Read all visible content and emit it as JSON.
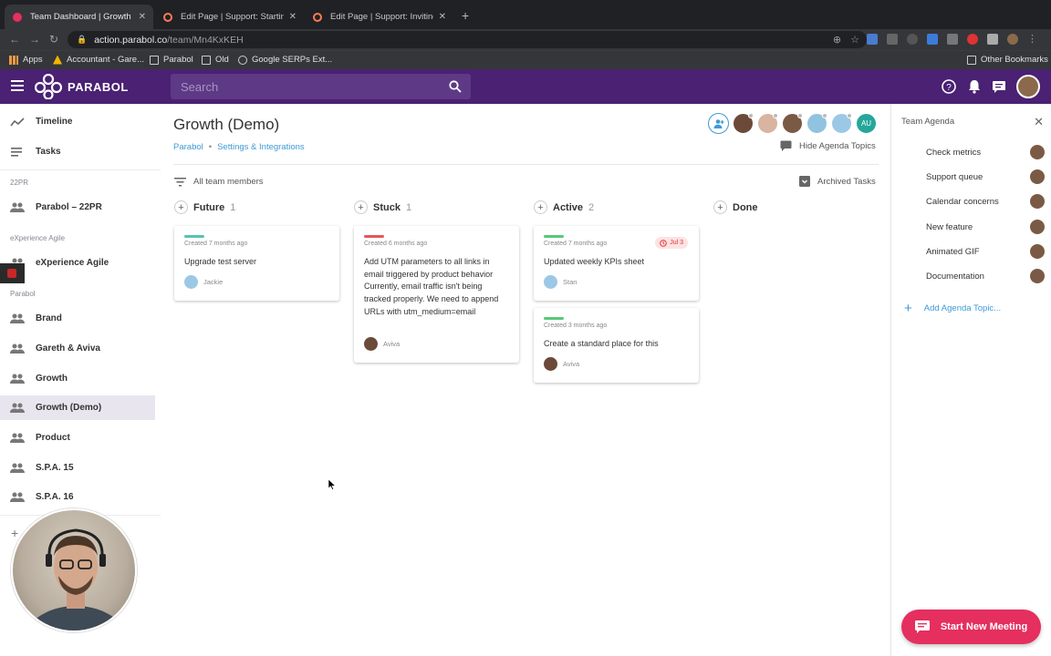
{
  "browser": {
    "tabs": [
      {
        "title": "Team Dashboard | Growth (Demo)",
        "active": true
      },
      {
        "title": "Edit Page | Support: Starting a Meeting"
      },
      {
        "title": "Edit Page | Support: Inviting & Managing"
      }
    ],
    "url_host": "action.parabol.co",
    "url_path": "/team/Mn4KxKEH",
    "bookmarks": [
      "Apps",
      "Accountant - Gare...",
      "Parabol",
      "Old",
      "Google SERPs Ext..."
    ],
    "other_bookmarks": "Other Bookmarks"
  },
  "header": {
    "brand": "PARABOL",
    "search_placeholder": "Search"
  },
  "sidebar": {
    "top_items": [
      {
        "label": "Timeline",
        "icon": "timeline-icon"
      },
      {
        "label": "Tasks",
        "icon": "tasks-icon"
      }
    ],
    "groups": [
      {
        "name": "22PR",
        "items": [
          {
            "label": "Parabol – 22PR"
          }
        ]
      },
      {
        "name": "eXperience Agile",
        "items": [
          {
            "label": "eXperience Agile"
          }
        ]
      },
      {
        "name": "Parabol",
        "items": [
          {
            "label": "Brand"
          },
          {
            "label": "Gareth & Aviva"
          },
          {
            "label": "Growth"
          },
          {
            "label": "Growth (Demo)",
            "selected": true
          },
          {
            "label": "Product"
          },
          {
            "label": "S.P.A. 15"
          },
          {
            "label": "S.P.A. 16"
          }
        ]
      }
    ]
  },
  "main": {
    "title": "Growth (Demo)",
    "breadcrumb": [
      "Parabol",
      "Settings & Integrations"
    ],
    "team_avatars": [
      "add-member",
      "person",
      "person",
      "person",
      "person",
      "person",
      "AU"
    ],
    "hide_agenda_label": "Hide Agenda Topics",
    "filter_label": "All team members",
    "archived_label": "Archived Tasks",
    "columns": [
      {
        "name": "Future",
        "count": "1",
        "cards": [
          {
            "created": "Created 7 months ago",
            "text": "Upgrade test server",
            "owner": "Jackie",
            "color": "#55c3b3"
          }
        ]
      },
      {
        "name": "Stuck",
        "count": "1",
        "cards": [
          {
            "created": "Created 6 months ago",
            "text": "Add UTM parameters to all links in email triggered by product behavior Currently, email traffic isn't being tracked properly. We need to append URLs with utm_medium=email",
            "owner": "Aviva",
            "color": "#e55757"
          }
        ]
      },
      {
        "name": "Active",
        "count": "2",
        "cards": [
          {
            "created": "Created 7 months ago",
            "text": "Updated weekly KPIs sheet",
            "owner": "Stan",
            "color": "#57c878",
            "due": "Jul 3"
          },
          {
            "created": "Created 3 months ago",
            "text": "Create a standard place for this",
            "owner": "Aviva",
            "color": "#57c878"
          }
        ]
      },
      {
        "name": "Done",
        "count": "",
        "cards": []
      }
    ]
  },
  "agenda": {
    "title": "Team Agenda",
    "topics": [
      "Check metrics",
      "Support queue",
      "Calendar concerns",
      "New feature",
      "Animated GIF",
      "Documentation"
    ],
    "add_label": "Add Agenda Topic..."
  },
  "start_meeting_label": "Start New Meeting",
  "colors": {
    "brand": "#4a2173",
    "accent": "#e52f5e",
    "link": "#3e9ad6"
  }
}
